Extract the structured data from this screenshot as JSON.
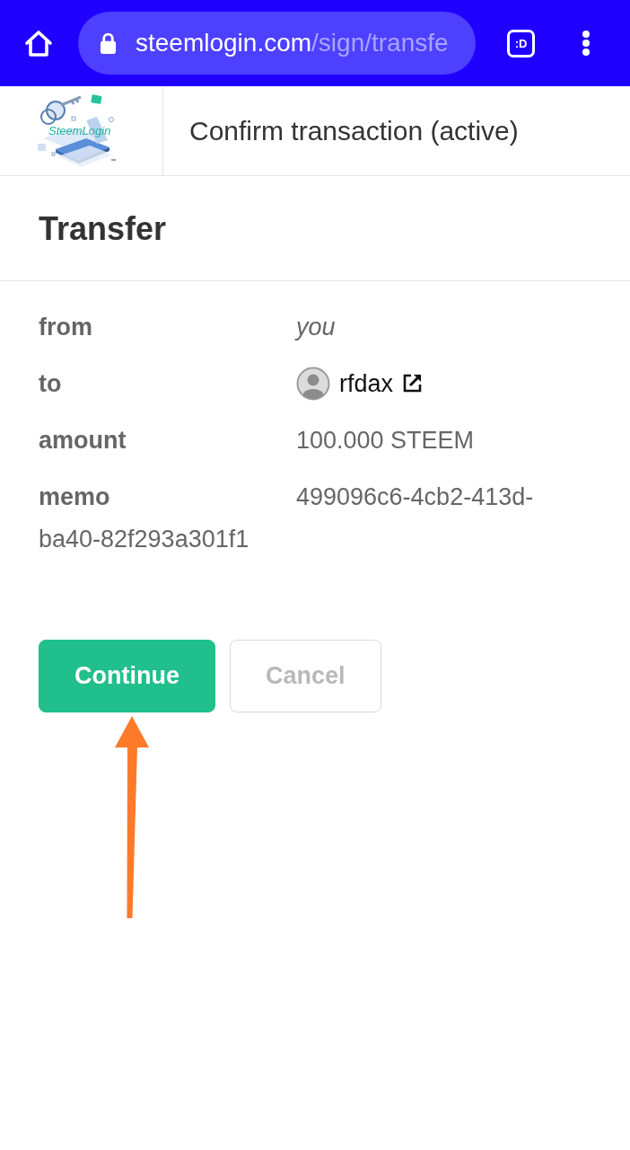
{
  "browser": {
    "url": {
      "host": "steemlogin.com",
      "path": "/sign/transfe"
    },
    "tabs_button": ":D"
  },
  "header": {
    "logo_text": "SteemLogin",
    "title": "Confirm transaction (active)"
  },
  "operation": {
    "title": "Transfer",
    "fields": [
      {
        "label": "from",
        "value": "you",
        "kind": "self"
      },
      {
        "label": "to",
        "value": "rfdax",
        "kind": "account"
      },
      {
        "label": "amount",
        "value": "100.000 STEEM",
        "kind": "text"
      },
      {
        "label": "memo",
        "value_lines": [
          "499096c6-4cb2-413d-",
          "ba40-82f293a301f1"
        ],
        "kind": "wrapped"
      }
    ]
  },
  "buttons": [
    {
      "label": "Continue",
      "kind": "primary"
    },
    {
      "label": "Cancel",
      "kind": "secondary"
    }
  ],
  "annotation": {
    "kind": "arrow"
  }
}
